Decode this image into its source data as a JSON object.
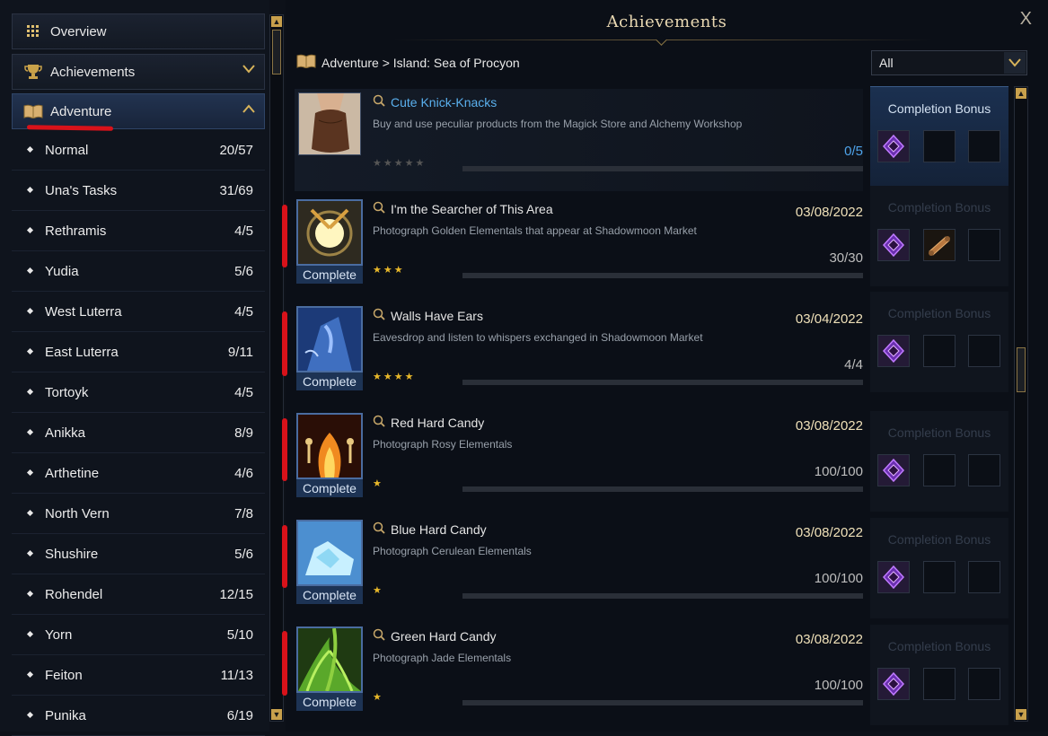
{
  "sidebar": {
    "nav": {
      "overview": "Overview",
      "achievements": "Achievements",
      "adventure": "Adventure"
    },
    "categories": [
      {
        "name": "Normal",
        "count": "20/57"
      },
      {
        "name": "Una's Tasks",
        "count": "31/69"
      },
      {
        "name": "Rethramis",
        "count": "4/5"
      },
      {
        "name": "Yudia",
        "count": "5/6"
      },
      {
        "name": "West Luterra",
        "count": "4/5"
      },
      {
        "name": "East Luterra",
        "count": "9/11"
      },
      {
        "name": "Tortoyk",
        "count": "4/5"
      },
      {
        "name": "Anikka",
        "count": "8/9"
      },
      {
        "name": "Arthetine",
        "count": "4/6"
      },
      {
        "name": "North Vern",
        "count": "7/8"
      },
      {
        "name": "Shushire",
        "count": "5/6"
      },
      {
        "name": "Rohendel",
        "count": "12/15"
      },
      {
        "name": "Yorn",
        "count": "5/10"
      },
      {
        "name": "Feiton",
        "count": "11/13"
      },
      {
        "name": "Punika",
        "count": "6/19"
      }
    ]
  },
  "window": {
    "title": "Achievements",
    "close": "X",
    "breadcrumb": "Adventure > Island: Sea of Procyon",
    "filter": "All"
  },
  "achievements": [
    {
      "name": "Cute Knick-Knacks",
      "desc": "Buy and use peculiar products from the Magick Store and Alchemy Workshop",
      "date": "",
      "progress": "0/5",
      "stars": "★★★★★",
      "complete": ""
    },
    {
      "name": "I'm the Searcher of This Area",
      "desc": "Photograph Golden Elementals that appear at Shadowmoon Market",
      "date": "03/08/2022",
      "progress": "30/30",
      "stars": "★★★",
      "complete": "Complete"
    },
    {
      "name": "Walls Have Ears",
      "desc": "Eavesdrop and listen to whispers exchanged in Shadowmoon Market",
      "date": "03/04/2022",
      "progress": "4/4",
      "stars": "★★★★",
      "complete": "Complete"
    },
    {
      "name": "Red Hard Candy",
      "desc": "Photograph Rosy Elementals",
      "date": "03/08/2022",
      "progress": "100/100",
      "stars": "★",
      "complete": "Complete"
    },
    {
      "name": "Blue Hard Candy",
      "desc": "Photograph Cerulean Elementals",
      "date": "03/08/2022",
      "progress": "100/100",
      "stars": "★",
      "complete": "Complete"
    },
    {
      "name": "Green Hard Candy",
      "desc": "Photograph Jade Elementals",
      "date": "03/08/2022",
      "progress": "100/100",
      "stars": "★",
      "complete": "Complete"
    }
  ],
  "bonus_label": "Completion Bonus",
  "icons": {
    "overview": "grid-icon",
    "achievements": "trophy-icon",
    "adventure": "book-icon",
    "search": "magnifier-icon",
    "reward": "purple-gem-icon",
    "scroll_reward": "scroll-icon"
  },
  "colors": {
    "accent_gold": "#d7b35a",
    "complete_blue": "#1d3354",
    "progress_blue": "#4ea3ea",
    "annotation_red": "#d8121a"
  }
}
